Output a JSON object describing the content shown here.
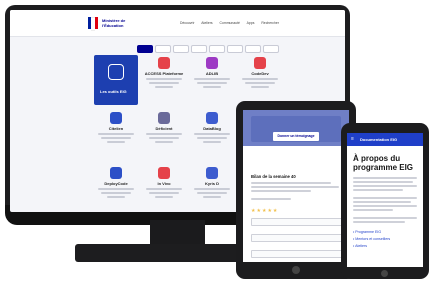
{
  "monitor": {
    "brand_text": "Ministère de l'Éducation",
    "nav": [
      "Découvrir",
      "Ateliers",
      "Communauté",
      "Apps",
      "Rechercher"
    ],
    "feature_card": {
      "label": "Les outils EIG",
      "icon": "link-icon"
    },
    "cards": [
      {
        "title": "ACCESS Plateforme",
        "icon": "sparkle-icon",
        "color": "#e5424a"
      },
      {
        "title": "ADLIB",
        "icon": "x-cross-icon",
        "color": "#9d3ac4"
      },
      {
        "title": "CodeDev",
        "icon": "star-icon",
        "color": "#e5424a"
      },
      {
        "title": "Citelien",
        "icon": "shield-icon",
        "color": "#2c4fc7"
      },
      {
        "title": "Déficient",
        "icon": "mask-icon",
        "color": "#6a6a9a"
      },
      {
        "title": "DataBlog",
        "icon": "phone-icon",
        "color": "#3d5ccf"
      },
      {
        "title": "DeployCode",
        "icon": "brackets-icon",
        "color": "#2c4fc7"
      },
      {
        "title": "In Vivo",
        "icon": "brush-icon",
        "color": "#e5424a"
      },
      {
        "title": "Kyris D",
        "icon": "scribble-icon",
        "color": "#3d5ccf"
      }
    ]
  },
  "tablet": {
    "banner_button": "Donner un témoignage",
    "form_title": "Bilan de la semaine 40"
  },
  "phone": {
    "header_title": "Documentation EIG",
    "page_title": "À propos du programme EIG",
    "links": [
      "Programme EIG",
      "Mentors et conseillers",
      "Ateliers"
    ]
  }
}
